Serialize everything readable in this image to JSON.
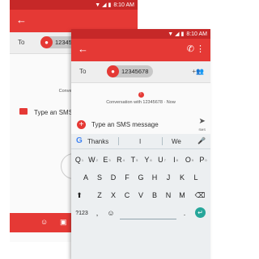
{
  "back_screen": {
    "status_time": "8:10 AM",
    "to_label": "To",
    "recipient_avatar": "person-icon",
    "recipient_partial": "12345",
    "conversation_partial": "Conversation v",
    "compose_placeholder_partial": "Type an SMS",
    "touch_hint_partial": "Touc"
  },
  "front_screen": {
    "status_time": "8:10 AM",
    "to_label": "To",
    "recipient": "12345678",
    "conversation_info": "Conversation with 12345678 · Now",
    "compose_placeholder": "Type an SMS message",
    "send_label": "SMS",
    "suggestions": [
      "Thanks",
      "I",
      "We"
    ],
    "keyboard": {
      "row1": [
        "Q",
        "W",
        "E",
        "R",
        "T",
        "Y",
        "U",
        "I",
        "O",
        "P"
      ],
      "row1_hints": [
        "1",
        "2",
        "3",
        "4",
        "5",
        "6",
        "7",
        "8",
        "9",
        "0"
      ],
      "row2": [
        "A",
        "S",
        "D",
        "F",
        "G",
        "H",
        "J",
        "K",
        "L"
      ],
      "row3": [
        "Z",
        "X",
        "C",
        "V",
        "B",
        "N",
        "M"
      ],
      "symbols_key": "?123",
      "comma_key": ",",
      "period_key": "."
    }
  },
  "colors": {
    "accent": "#e53935",
    "status": "#c62828",
    "enter": "#26a69a"
  }
}
